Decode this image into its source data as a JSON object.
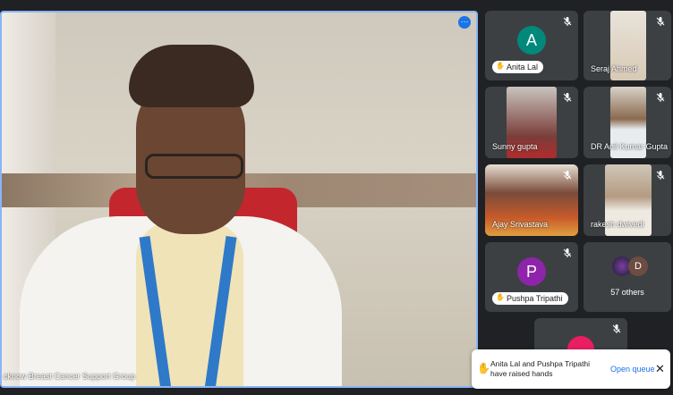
{
  "main_tile": {
    "name_label": "cknow Breast Cancer Support Group"
  },
  "tiles": [
    {
      "name": "Anita Lal",
      "hand_raised": true,
      "avatar_letter": "A",
      "avatar_color": "#00897b"
    },
    {
      "name": "Seraj Ahmed",
      "hand_raised": false
    },
    {
      "name": "Sunny gupta",
      "hand_raised": false
    },
    {
      "name": "DR Anil Kumar Gupta",
      "hand_raised": false
    },
    {
      "name": "Ajay Srivastava",
      "hand_raised": false
    },
    {
      "name": "rakesh dwivedi",
      "hand_raised": false
    },
    {
      "name": "Pushpa Tripathi",
      "hand_raised": true,
      "avatar_letter": "P",
      "avatar_color": "#8e24aa"
    },
    {
      "name": "57 others",
      "hand_raised": false,
      "avatar_letter": "D",
      "avatar_color": "#6d4c41"
    }
  ],
  "notification": {
    "text": "Anita Lal and Pushpa Tripathi have raised hands",
    "action_label": "Open queue",
    "close_glyph": "✕"
  },
  "icons": {
    "more": "⋯",
    "mic_off": "mic-off-icon"
  }
}
